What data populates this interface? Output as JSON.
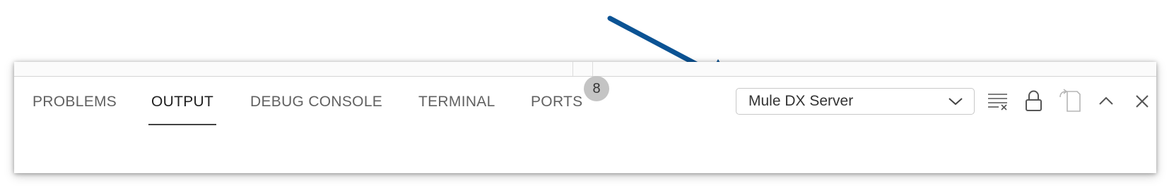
{
  "panel": {
    "tabs": [
      {
        "label": "PROBLEMS",
        "active": false
      },
      {
        "label": "OUTPUT",
        "active": true
      },
      {
        "label": "DEBUG CONSOLE",
        "active": false
      },
      {
        "label": "TERMINAL",
        "active": false
      },
      {
        "label": "PORTS",
        "active": false
      }
    ],
    "ports_badge": "8",
    "output_channel": {
      "selected": "Mule DX Server"
    },
    "actions": [
      "clear-output-icon",
      "lock-scroll-icon",
      "open-in-editor-icon",
      "maximize-panel-icon",
      "close-panel-icon"
    ]
  },
  "annotation": {
    "arrow_color": "#0b5394"
  },
  "colors": {
    "tab_text": "#616161",
    "tab_active": "#1f1f1f",
    "badge_bg": "#c4c4c4"
  }
}
